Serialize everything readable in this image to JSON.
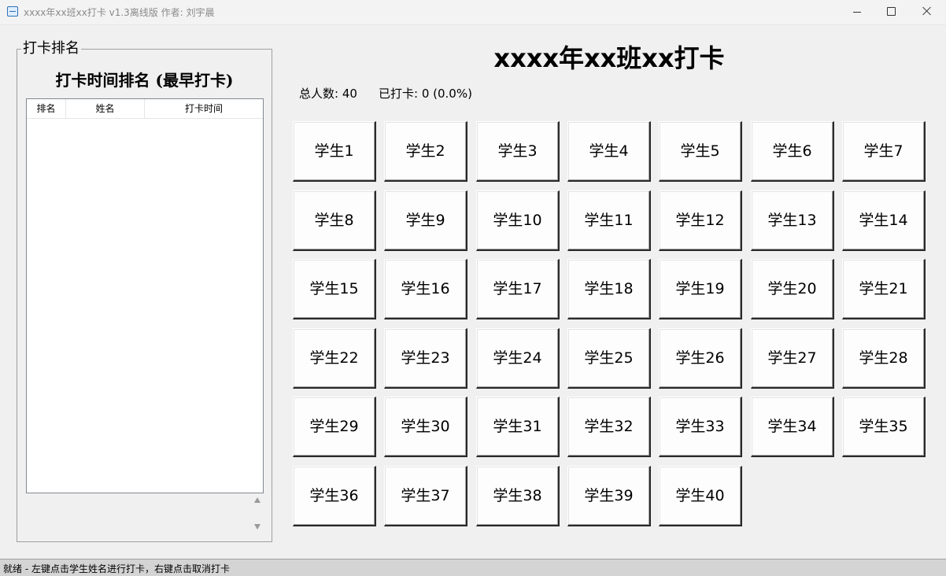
{
  "window": {
    "title": "xxxx年xx班xx打卡 v1.3离线版 作者: 刘宇晨"
  },
  "left_panel": {
    "group_label": "打卡排名",
    "heading": "打卡时间排名 (最早打卡)",
    "columns": [
      "排名",
      "姓名",
      "打卡时间"
    ]
  },
  "main": {
    "title": "xxxx年xx班xx打卡",
    "total_label": "总人数: 40",
    "checked_label": "已打卡: 0 (0.0%)"
  },
  "students": [
    "学生1",
    "学生2",
    "学生3",
    "学生4",
    "学生5",
    "学生6",
    "学生7",
    "学生8",
    "学生9",
    "学生10",
    "学生11",
    "学生12",
    "学生13",
    "学生14",
    "学生15",
    "学生16",
    "学生17",
    "学生18",
    "学生19",
    "学生20",
    "学生21",
    "学生22",
    "学生23",
    "学生24",
    "学生25",
    "学生26",
    "学生27",
    "学生28",
    "学生29",
    "学生30",
    "学生31",
    "学生32",
    "学生33",
    "学生34",
    "学生35",
    "学生36",
    "学生37",
    "学生38",
    "学生39",
    "学生40"
  ],
  "status_bar": {
    "text": "就绪 - 左键点击学生姓名进行打卡，右键点击取消打卡"
  },
  "colors": {
    "window_bg": "#f0f0f0",
    "status_bar_bg": "#d4d4d4",
    "button_bg": "#fdfdfd"
  }
}
